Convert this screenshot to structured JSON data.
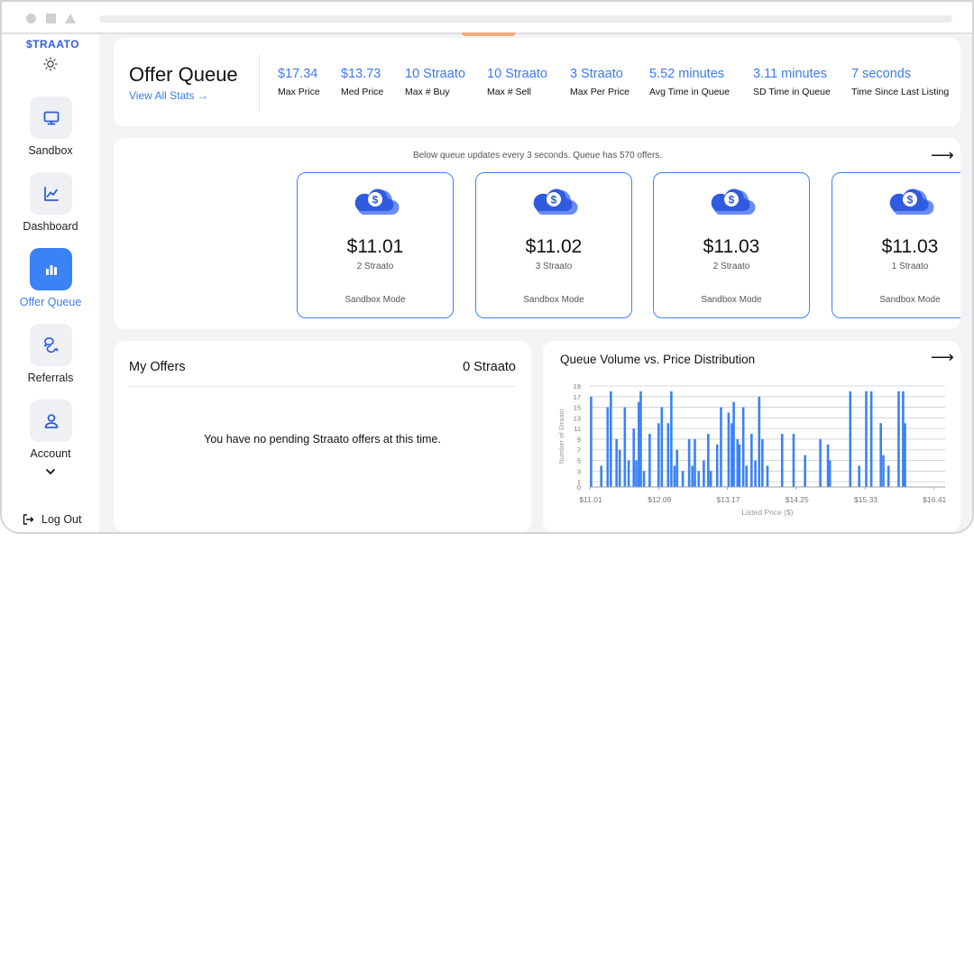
{
  "app": {
    "logo": "$TRAATO"
  },
  "sidebar": {
    "items": [
      {
        "label": "Sandbox",
        "icon": "monitor-icon",
        "active": false
      },
      {
        "label": "Dashboard",
        "icon": "line-chart-icon",
        "active": false
      },
      {
        "label": "Offer Queue",
        "icon": "bar-chart-icon",
        "active": true
      },
      {
        "label": "Referrals",
        "icon": "chat-bubbles-icon",
        "active": false
      },
      {
        "label": "Account",
        "icon": "user-icon",
        "active": false
      }
    ],
    "logout_label": "Log Out"
  },
  "header": {
    "title": "Offer Queue",
    "link": "View All Stats →",
    "stats": [
      {
        "value": "$17.34",
        "label": "Max Price"
      },
      {
        "value": "$13.73",
        "label": "Med Price"
      },
      {
        "value": "10 Straato",
        "label": "Max # Buy"
      },
      {
        "value": "10 Straato",
        "label": "Max # Sell"
      },
      {
        "value": "3 Straato",
        "label": "Max Per Price"
      },
      {
        "value": "5.52 minutes",
        "label": "Avg Time in Queue"
      },
      {
        "value": "3.11 minutes",
        "label": "SD Time in Queue"
      },
      {
        "value": "7 seconds",
        "label": "Time Since Last Listing"
      }
    ]
  },
  "queue": {
    "note": "Below queue updates every 3 seconds. Queue has 570 offers.",
    "arrow": "⟶",
    "offers": [
      {
        "price": "$11.01",
        "qty": "2 Straato",
        "mode": "Sandbox Mode"
      },
      {
        "price": "$11.02",
        "qty": "3 Straato",
        "mode": "Sandbox Mode"
      },
      {
        "price": "$11.03",
        "qty": "2 Straato",
        "mode": "Sandbox Mode"
      },
      {
        "price": "$11.03",
        "qty": "1 Straato",
        "mode": "Sandbox Mode"
      }
    ]
  },
  "my_offers": {
    "title": "My Offers",
    "total": "0 Straato",
    "empty_message": "You have no pending Straato offers at this time."
  },
  "colors": {
    "accent": "#3b82f6",
    "link": "#3b7bf0",
    "icon_dark": "#2f5be0",
    "icon_light": "#6b8cf5"
  },
  "chart_data": {
    "type": "bar",
    "title": "Queue Volume vs. Price Distribution",
    "xlabel": "Listed Price ($)",
    "ylabel": "Number of Straato",
    "x_ticks": [
      "$11.01",
      "$12.09",
      "$13.17",
      "$14.25",
      "$15.33",
      "$16.41"
    ],
    "y_ticks": [
      "0",
      "1",
      "3",
      "5",
      "7",
      "9",
      "11",
      "13",
      "15",
      "17",
      "19"
    ],
    "ylim": [
      0,
      19
    ],
    "xlim": [
      11.01,
      16.59
    ],
    "grid": true,
    "arrow": "⟶",
    "series": [
      {
        "x": [
          11.03,
          11.19,
          11.29,
          11.34,
          11.43,
          11.48,
          11.56,
          11.62,
          11.7,
          11.74,
          11.78,
          11.81,
          11.86,
          11.95,
          12.09,
          12.14,
          12.24,
          12.29,
          12.34,
          12.38,
          12.47,
          12.57,
          12.62,
          12.66,
          12.72,
          12.8,
          12.87,
          12.91,
          13.01,
          13.07,
          13.19,
          13.24,
          13.27,
          13.33,
          13.36,
          13.42,
          13.47,
          13.55,
          13.61,
          13.67,
          13.72,
          13.8,
          14.03,
          14.21,
          14.39,
          14.63,
          14.75,
          14.78,
          15.1,
          15.24,
          15.35,
          15.43,
          15.58,
          15.62,
          15.7,
          15.86,
          15.93,
          15.96
        ],
        "values": [
          17,
          4,
          15,
          18,
          9,
          7,
          15,
          5,
          11,
          5,
          16,
          18,
          3,
          10,
          12,
          15,
          12,
          18,
          4,
          7,
          3,
          9,
          4,
          9,
          3,
          5,
          10,
          3,
          8,
          15,
          14,
          12,
          16,
          9,
          8,
          15,
          4,
          10,
          5,
          17,
          9,
          4,
          10,
          10,
          6,
          9,
          8,
          5,
          18,
          4,
          18,
          18,
          12,
          6,
          4,
          18,
          18,
          12
        ]
      }
    ]
  }
}
